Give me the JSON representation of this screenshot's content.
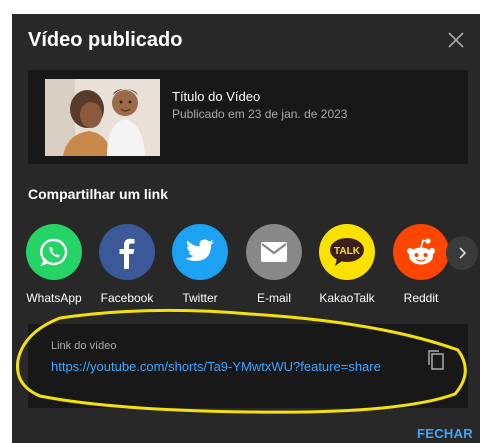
{
  "dialog": {
    "title": "Vídeo publicado",
    "close_icon": "close-icon"
  },
  "video": {
    "title": "Título do Vídeo",
    "published": "Publicado em 23 de jan. de 2023",
    "thumbnail_icon": "video-thumbnail"
  },
  "share": {
    "heading": "Compartilhar um link",
    "items": [
      {
        "label": "WhatsApp",
        "icon": "whatsapp-icon",
        "color": "#25d366"
      },
      {
        "label": "Facebook",
        "icon": "facebook-icon",
        "color": "#3b5998"
      },
      {
        "label": "Twitter",
        "icon": "twitter-icon",
        "color": "#1da1f2"
      },
      {
        "label": "E-mail",
        "icon": "email-icon",
        "color": "#888888"
      },
      {
        "label": "KakaoTalk",
        "icon": "kakaotalk-icon",
        "color": "#fae100"
      },
      {
        "label": "Reddit",
        "icon": "reddit-icon",
        "color": "#ff4500"
      }
    ],
    "next_icon": "chevron-right-icon"
  },
  "link": {
    "label": "Link do vídeo",
    "url": "https://youtube.com/shorts/Ta9-YMwtxWU?feature=share",
    "copy_icon": "copy-icon"
  },
  "actions": {
    "close_label": "FECHAR"
  },
  "colors": {
    "dialog_bg": "#282828",
    "card_bg": "#181818",
    "link_blue": "#3ea6ff",
    "annotation_yellow": "#f5e10a"
  }
}
